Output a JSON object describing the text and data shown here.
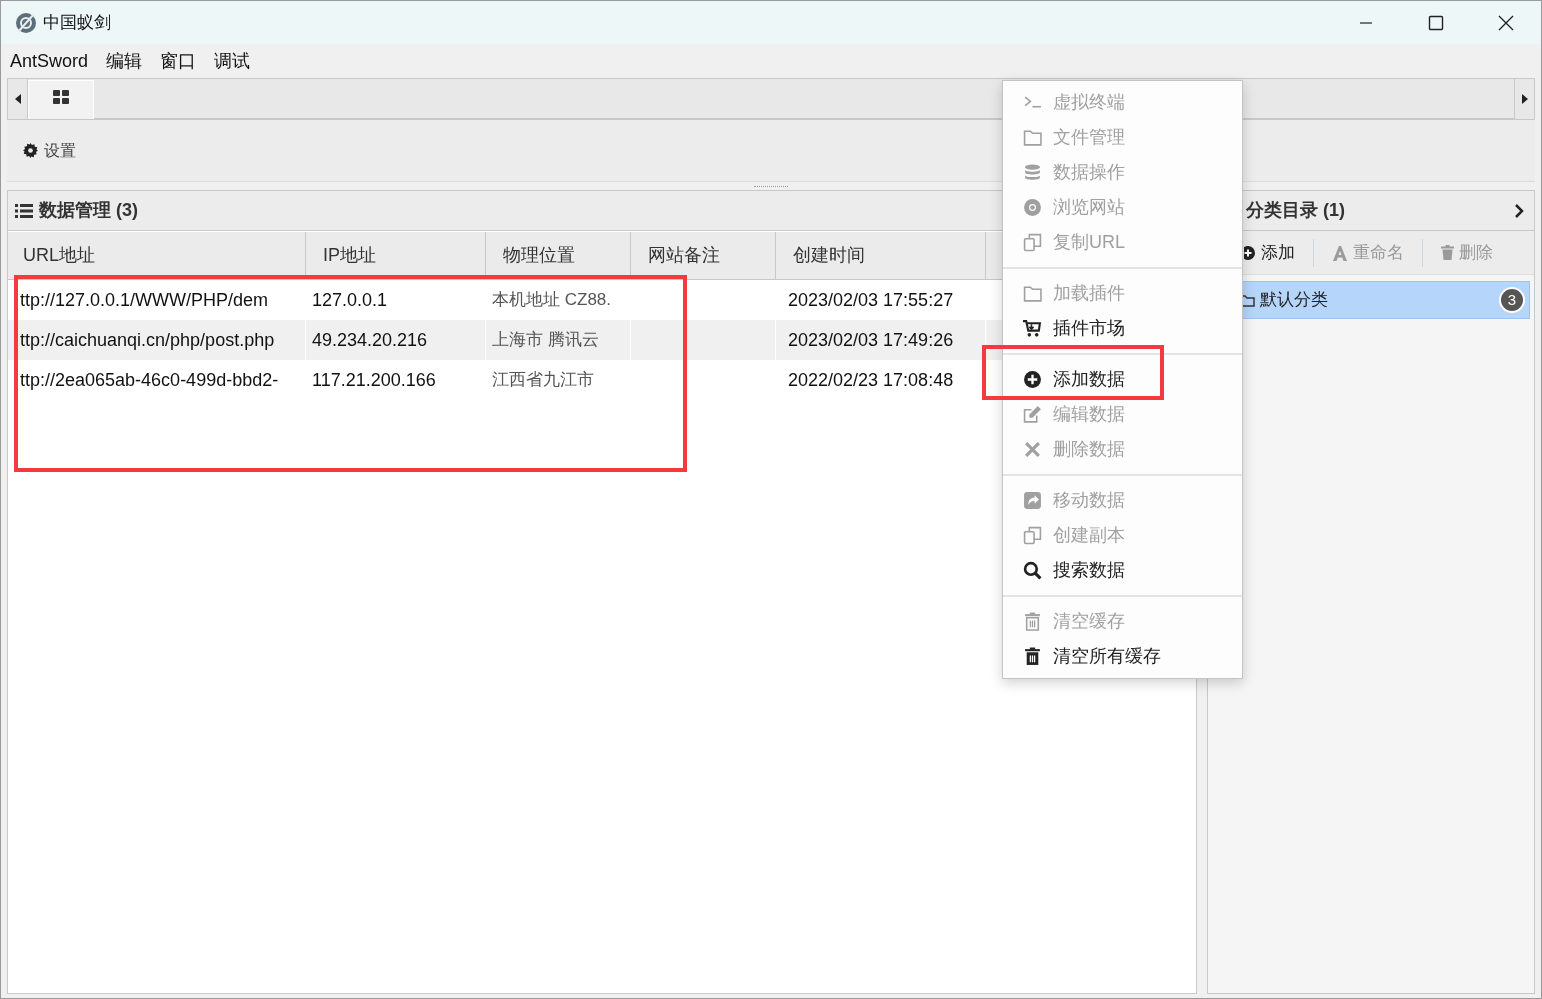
{
  "window": {
    "title": "中国蚁剑"
  },
  "menu_bar": [
    "AntSword",
    "编辑",
    "窗口",
    "调试"
  ],
  "toolbar": {
    "settings": "设置"
  },
  "data_panel": {
    "title": "数据管理 (3)",
    "columns": [
      "URL地址",
      "IP地址",
      "物理位置",
      "网站备注",
      "创建时间"
    ],
    "rows": [
      {
        "cells": [
          "ttp://127.0.0.1/WWW/PHP/dem",
          "127.0.0.1",
          "本机地址 CZ88.",
          "",
          "2023/02/03 17:55:27"
        ]
      },
      {
        "cells": [
          "ttp://caichuanqi.cn/php/post.php",
          "49.234.20.216",
          "上海市 腾讯云",
          "",
          "2023/02/03 17:49:26"
        ]
      },
      {
        "cells": [
          "ttp://2ea065ab-46c0-499d-bbd2-",
          "117.21.200.166",
          "江西省九江市",
          "",
          "2022/02/23 17:08:48"
        ]
      }
    ]
  },
  "category_panel": {
    "title": "分类目录 (1)",
    "actions": [
      {
        "label": "添加",
        "disabled": false
      },
      {
        "label": "重命名",
        "disabled": true
      },
      {
        "label": "删除",
        "disabled": true
      }
    ],
    "items": [
      {
        "label": "默认分类",
        "count": "3",
        "selected": true
      }
    ]
  },
  "context_menu": {
    "sections": [
      [
        {
          "label": "虚拟终端",
          "disabled": true
        },
        {
          "label": "文件管理",
          "disabled": true
        },
        {
          "label": "数据操作",
          "disabled": true
        },
        {
          "label": "浏览网站",
          "disabled": true
        },
        {
          "label": "复制URL",
          "disabled": true
        }
      ],
      [
        {
          "label": "加载插件",
          "disabled": true
        },
        {
          "label": "插件市场",
          "disabled": false
        }
      ],
      [
        {
          "label": "添加数据",
          "disabled": false
        },
        {
          "label": "编辑数据",
          "disabled": true
        },
        {
          "label": "删除数据",
          "disabled": true
        }
      ],
      [
        {
          "label": "移动数据",
          "disabled": true
        },
        {
          "label": "创建副本",
          "disabled": true
        },
        {
          "label": "搜索数据",
          "disabled": false
        }
      ],
      [
        {
          "label": "清空缓存",
          "disabled": true
        },
        {
          "label": "清空所有缓存",
          "disabled": false
        }
      ]
    ]
  }
}
